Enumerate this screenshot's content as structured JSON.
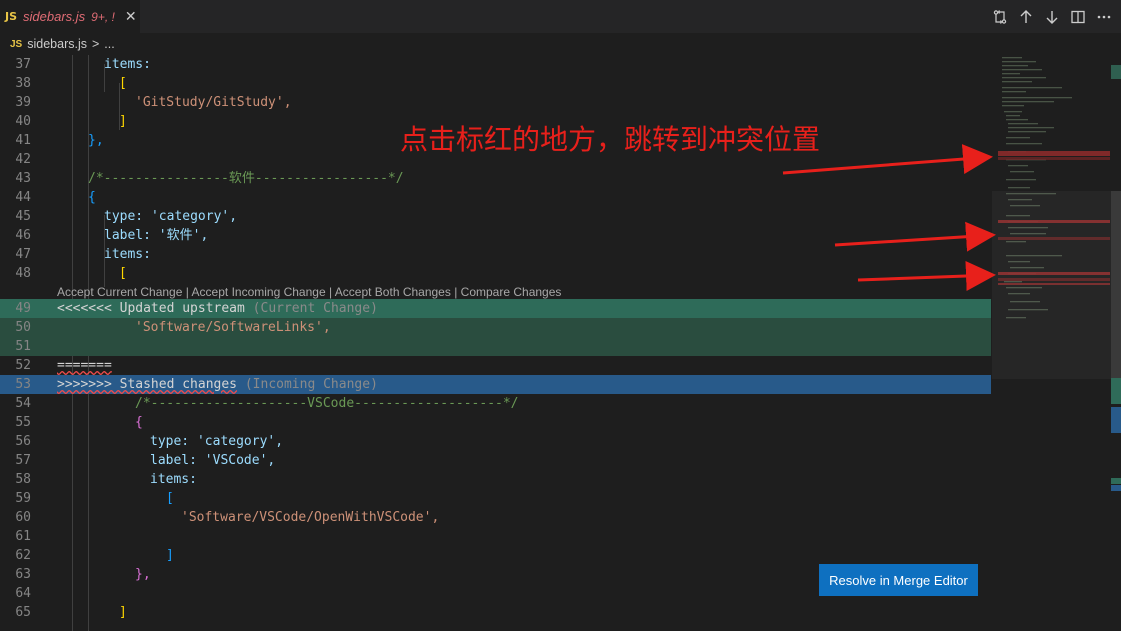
{
  "tab": {
    "name": "sidebars.js",
    "status": "9+, !",
    "lang_badge": "JS",
    "close_icon": "close-icon"
  },
  "toolbar": {
    "icons": [
      "compare-changes-icon",
      "arrow-up-icon",
      "arrow-down-icon",
      "split-editor-icon",
      "more-icon"
    ]
  },
  "breadcrumb": {
    "lang_badge": "JS",
    "file": "sidebars.js",
    "separator": ">",
    "rest": "..."
  },
  "annotation": "点击标红的地方，跳转到冲突位置",
  "codelens": [
    "Accept Current Change",
    "Accept Incoming Change",
    "Accept Both Changes",
    "Compare Changes"
  ],
  "codelens_sep": "|",
  "lines": [
    {
      "n": "37",
      "text": "items:"
    },
    {
      "n": "38",
      "text": "["
    },
    {
      "n": "39",
      "text": "'GitStudy/GitStudy',"
    },
    {
      "n": "40",
      "text": "]"
    },
    {
      "n": "41",
      "text": "},"
    },
    {
      "n": "42",
      "text": ""
    },
    {
      "n": "43",
      "text": "/*----------------软件-----------------*/"
    },
    {
      "n": "44",
      "text": "{"
    },
    {
      "n": "45",
      "text": "type: 'category',"
    },
    {
      "n": "46",
      "text": "label: '软件',"
    },
    {
      "n": "47",
      "text": "items:"
    },
    {
      "n": "48",
      "text": "["
    },
    {
      "n": "49",
      "text": "<<<<<<< Updated upstream",
      "label": "(Current Change)"
    },
    {
      "n": "50",
      "text": "'Software/SoftwareLinks',"
    },
    {
      "n": "51",
      "text": ""
    },
    {
      "n": "52",
      "text": "======="
    },
    {
      "n": "53",
      "text": ">>>>>>> Stashed changes",
      "label": "(Incoming Change)"
    },
    {
      "n": "54",
      "text": "/*--------------------VSCode-------------------*/"
    },
    {
      "n": "55",
      "text": "{"
    },
    {
      "n": "56",
      "text": "type: 'category',"
    },
    {
      "n": "57",
      "text": "label: 'VSCode',"
    },
    {
      "n": "58",
      "text": "items:"
    },
    {
      "n": "59",
      "text": "["
    },
    {
      "n": "60",
      "text": "'Software/VSCode/OpenWithVSCode',"
    },
    {
      "n": "61",
      "text": ""
    },
    {
      "n": "62",
      "text": "]"
    },
    {
      "n": "63",
      "text": "},"
    },
    {
      "n": "64",
      "text": ""
    },
    {
      "n": "65",
      "text": "]"
    }
  ],
  "resolve_button": "Resolve in Merge Editor",
  "colors": {
    "current_change": "#2a4d3f",
    "current_header": "#2e6b59",
    "incoming_header": "#285a8a",
    "annotation": "#e8201b",
    "button": "#0e70c0"
  }
}
